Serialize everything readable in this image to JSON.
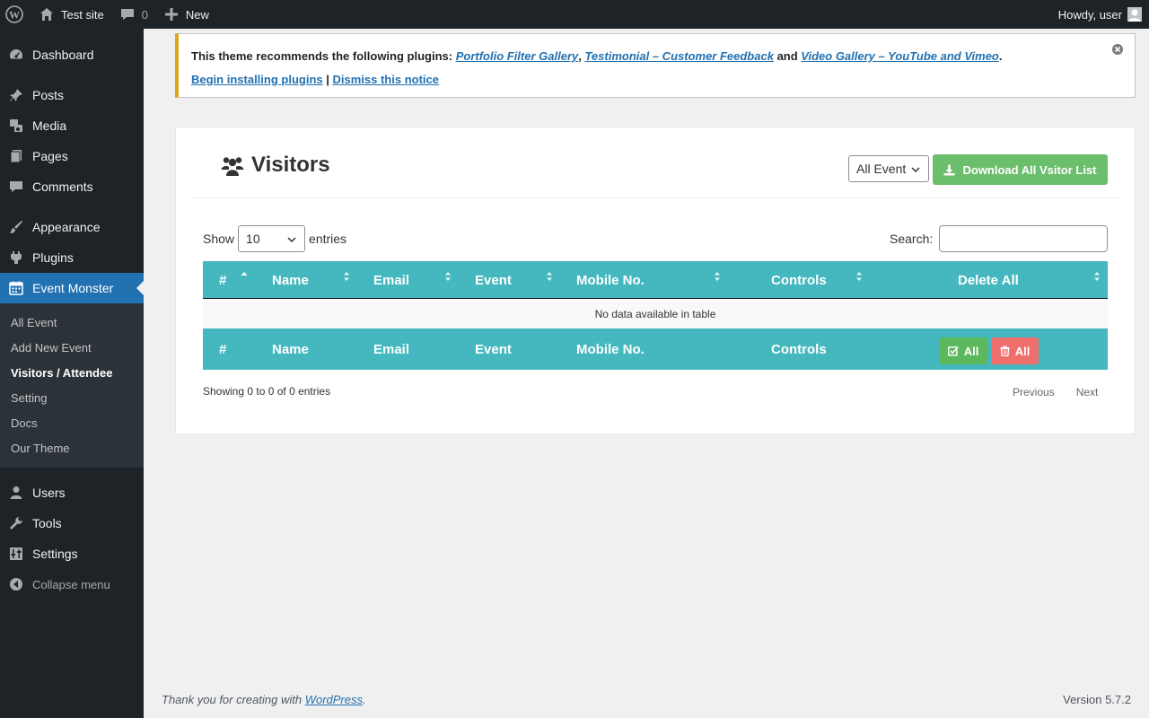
{
  "adminbar": {
    "site_name": "Test site",
    "comments_count": "0",
    "new_label": "New",
    "howdy": "Howdy, user"
  },
  "sidebar": {
    "items": [
      {
        "label": "Dashboard",
        "icon": "dashboard-icon"
      },
      {
        "label": "Posts",
        "icon": "pin-icon"
      },
      {
        "label": "Media",
        "icon": "media-icon"
      },
      {
        "label": "Pages",
        "icon": "pages-icon"
      },
      {
        "label": "Comments",
        "icon": "comment-icon"
      },
      {
        "label": "Appearance",
        "icon": "brush-icon"
      },
      {
        "label": "Plugins",
        "icon": "plug-icon"
      },
      {
        "label": "Event Monster",
        "icon": "calendar-icon"
      },
      {
        "label": "Users",
        "icon": "user-icon"
      },
      {
        "label": "Tools",
        "icon": "wrench-icon"
      },
      {
        "label": "Settings",
        "icon": "sliders-icon"
      },
      {
        "label": "Collapse menu",
        "icon": "collapse-icon"
      }
    ],
    "submenu": [
      "All Event",
      "Add New Event",
      "Visitors / Attendee",
      "Setting",
      "Docs",
      "Our Theme"
    ]
  },
  "notice": {
    "text_before": "This theme recommends the following plugins: ",
    "plugin1": "Portfolio Filter Gallery",
    "comma": ", ",
    "plugin2": "Testimonial – Customer Feedback",
    "and": " and ",
    "plugin3": "Video Gallery – YouTube and Vimeo",
    "period": ".",
    "install_link": "Begin installing plugins",
    "sep": " | ",
    "dismiss_link": "Dismiss this notice"
  },
  "panel": {
    "title": "Visitors",
    "event_select": "All Event",
    "download_button": "Download All Vsitor List",
    "show_label": "Show",
    "entries_value": "10",
    "entries_label": "entries",
    "search_label": "Search:",
    "search_value": ""
  },
  "table": {
    "headers": [
      "#",
      "Name",
      "Email",
      "Event",
      "Mobile No.",
      "Controls",
      "Delete All"
    ],
    "empty_message": "No data available in table",
    "footer_headers": [
      "#",
      "Name",
      "Email",
      "Event",
      "Mobile No.",
      "Controls"
    ],
    "select_all_label": "All",
    "delete_all_label": "All",
    "info": "Showing 0 to 0 of 0 entries",
    "previous": "Previous",
    "next": "Next"
  },
  "footer": {
    "thanks_before": "Thank you for creating with ",
    "wp_link": "WordPress",
    "thanks_after": ".",
    "version": "Version 5.7.2"
  },
  "colors": {
    "table_header": "#45b8bf",
    "download_button": "#5cb85c",
    "delete_button": "#ef6f6c",
    "select_button": "#5cb85c",
    "current_menu": "#2271b1",
    "notice_border": "#dba617"
  }
}
